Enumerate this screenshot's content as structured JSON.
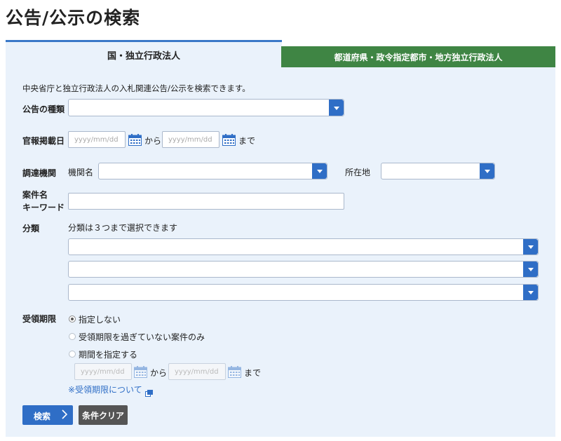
{
  "page": {
    "title": "公告/公示の検索"
  },
  "tabs": [
    {
      "label": "国・独立行政法人",
      "active": true
    },
    {
      "label": "都道府県・政令指定都市・地方独立行政法人",
      "active": false
    }
  ],
  "form": {
    "description": "中央省庁と独立行政法人の入札関連公告/公示を検索できます。",
    "notice_type": {
      "label": "公告の種類",
      "value": ""
    },
    "publish_date": {
      "label": "官報掲載日",
      "from_placeholder": "yyyy/mm/dd",
      "to_placeholder": "yyyy/mm/dd",
      "from_text": "から",
      "to_text": "まで"
    },
    "procurement": {
      "label": "調達機関",
      "org_label": "機関名",
      "org_value": "",
      "location_label": "所在地",
      "location_value": ""
    },
    "keyword": {
      "label_line1": "案件名",
      "label_line2": "キーワード",
      "value": ""
    },
    "category": {
      "label": "分類",
      "hint": "分類は３つまで選択できます",
      "selects": [
        "",
        "",
        ""
      ]
    },
    "deadline": {
      "label": "受領期限",
      "options": [
        {
          "label": "指定しない",
          "checked": true
        },
        {
          "label": "受領期限を過ぎていない案件のみ",
          "checked": false
        },
        {
          "label": "期間を指定する",
          "checked": false
        }
      ],
      "from_placeholder": "yyyy/mm/dd",
      "to_placeholder": "yyyy/mm/dd",
      "from_text": "から",
      "to_text": "まで",
      "help_link": "※受領期限について"
    }
  },
  "buttons": {
    "search": "検索",
    "clear": "条件クリア"
  },
  "colors": {
    "accent": "#2f6ec6",
    "tab_green": "#3f8544",
    "panel_bg": "#eaf2fb",
    "clear_btn": "#555555"
  }
}
